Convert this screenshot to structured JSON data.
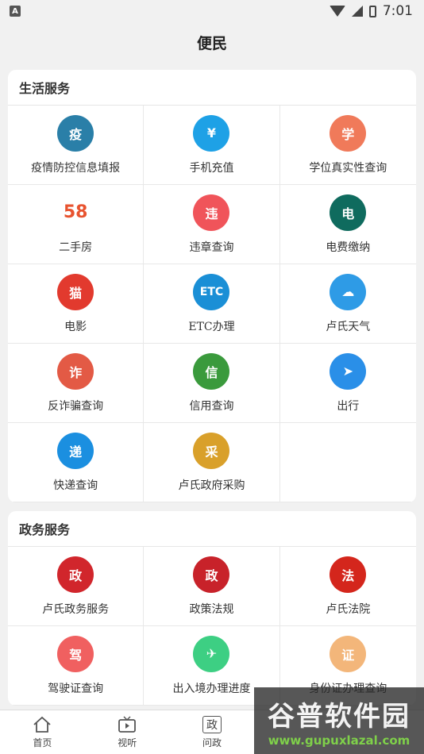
{
  "status_bar": {
    "time": "7:01",
    "left_badge": "A"
  },
  "header": {
    "title": "便民"
  },
  "sections": [
    {
      "title": "生活服务",
      "items": [
        {
          "label": "疫情防控信息填报",
          "icon": "epidemic-icon",
          "icon_text": "疫",
          "color": "#2a7fa8"
        },
        {
          "label": "手机充值",
          "icon": "phone-recharge-icon",
          "icon_text": "¥",
          "color": "#1ea1e6"
        },
        {
          "label": "学位真实性查询",
          "icon": "graduation-cap-icon",
          "icon_text": "学",
          "color": "#f07a5a"
        },
        {
          "label": "二手房",
          "icon": "58-icon",
          "icon_text": "58",
          "color": "#ffffff"
        },
        {
          "label": "违章查询",
          "icon": "traffic-violation-icon",
          "icon_text": "违",
          "color": "#f0545a"
        },
        {
          "label": "电费缴纳",
          "icon": "state-grid-icon",
          "icon_text": "电",
          "color": "#0f6b5e"
        },
        {
          "label": "电影",
          "icon": "movie-cat-icon",
          "icon_text": "猫",
          "color": "#e23a2e"
        },
        {
          "label": "ETC办理",
          "icon": "etc-icon",
          "icon_text": "ETC",
          "color": "#1a8fd6"
        },
        {
          "label": "卢氏天气",
          "icon": "weather-icon",
          "icon_text": "☁",
          "color": "#2e9be6"
        },
        {
          "label": "反诈骗查询",
          "icon": "anti-fraud-icon",
          "icon_text": "诈",
          "color": "#e35a45"
        },
        {
          "label": "信用查询",
          "icon": "credit-icon",
          "icon_text": "信",
          "color": "#3a9a3c"
        },
        {
          "label": "出行",
          "icon": "navigation-icon",
          "icon_text": "➤",
          "color": "#2a8fe8"
        },
        {
          "label": "快递查询",
          "icon": "express-icon",
          "icon_text": "递",
          "color": "#1b8fe0"
        },
        {
          "label": "卢氏政府采购",
          "icon": "government-procurement-icon",
          "icon_text": "采",
          "color": "#d9a02a"
        }
      ]
    },
    {
      "title": "政务服务",
      "items": [
        {
          "label": "卢氏政务服务",
          "icon": "gov-service-icon",
          "icon_text": "政",
          "color": "#d1262c"
        },
        {
          "label": "政策法规",
          "icon": "policy-icon",
          "icon_text": "政",
          "color": "#c8222a"
        },
        {
          "label": "卢氏法院",
          "icon": "court-icon",
          "icon_text": "法",
          "color": "#d4261c"
        },
        {
          "label": "驾驶证查询",
          "icon": "driver-license-icon",
          "icon_text": "驾",
          "color": "#f06060"
        },
        {
          "label": "出入境办理进度",
          "icon": "airplane-icon",
          "icon_text": "✈",
          "color": "#3dcf83"
        },
        {
          "label": "身份证办理查询",
          "icon": "id-card-icon",
          "icon_text": "证",
          "color": "#f3b67a"
        }
      ]
    }
  ],
  "tabs": [
    {
      "label": "首页",
      "icon": "home-icon"
    },
    {
      "label": "视听",
      "icon": "tv-icon"
    },
    {
      "label": "问政",
      "icon": "gov-icon",
      "glyph": "政"
    }
  ],
  "watermark": {
    "title": "谷普软件园",
    "url": "www.gupuxlazal.com"
  }
}
